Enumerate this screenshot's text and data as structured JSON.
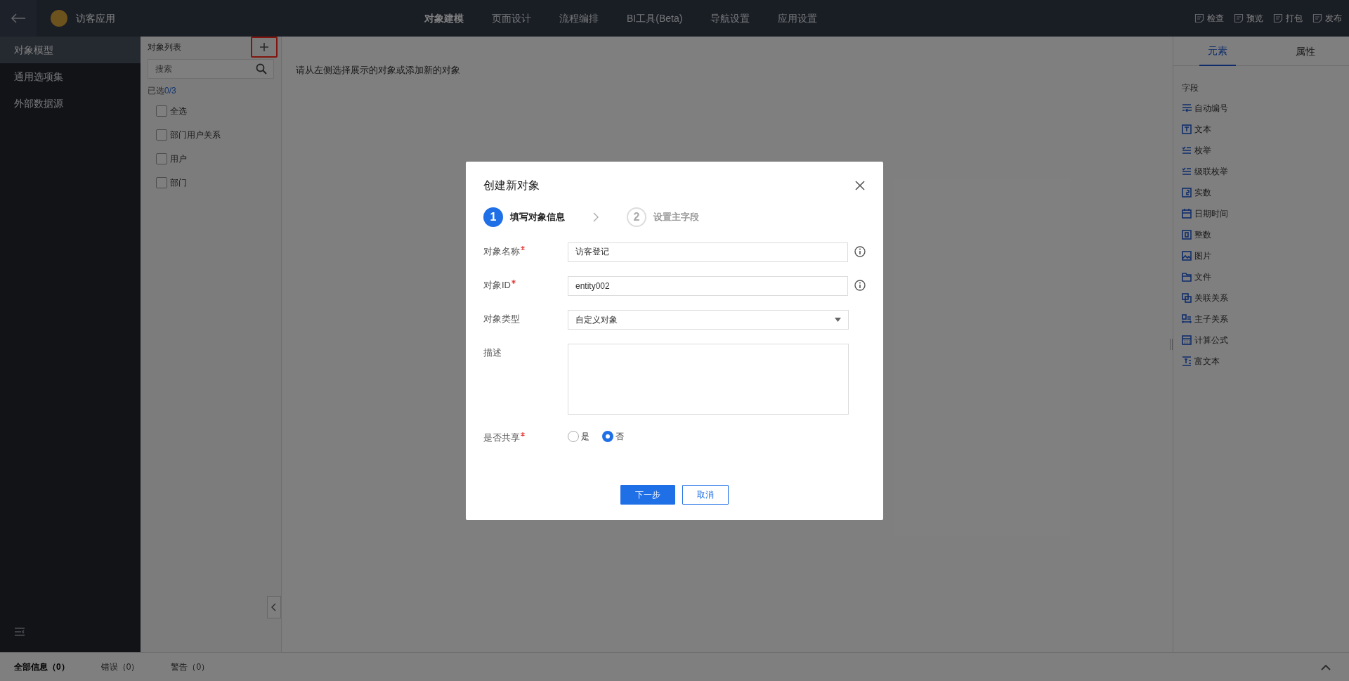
{
  "header": {
    "app_name": "访客应用",
    "nav_tabs": [
      {
        "label": "对象建模",
        "selected": true
      },
      {
        "label": "页面设计",
        "selected": false
      },
      {
        "label": "流程编排",
        "selected": false
      },
      {
        "label": "BI工具(Beta)",
        "selected": false
      },
      {
        "label": "导航设置",
        "selected": false
      },
      {
        "label": "应用设置",
        "selected": false
      }
    ],
    "actions": [
      "检查",
      "预览",
      "打包",
      "发布"
    ]
  },
  "sidebar": {
    "items": [
      {
        "label": "对象模型",
        "selected": true
      },
      {
        "label": "通用选项集",
        "selected": false
      },
      {
        "label": "外部数据源",
        "selected": false
      }
    ]
  },
  "object_list": {
    "title": "对象列表",
    "search_placeholder": "搜索",
    "selected_label": "已选",
    "selected_count": "0/3",
    "items": [
      {
        "label": "全选",
        "checked": false
      },
      {
        "label": "部门用户关系",
        "checked": false
      },
      {
        "label": "用户",
        "checked": false
      },
      {
        "label": "部门",
        "checked": false
      }
    ]
  },
  "main_hint": "请从左侧选择展示的对象或添加新的对象",
  "right_panel": {
    "tabs": [
      {
        "label": "元素",
        "selected": true
      },
      {
        "label": "属性",
        "selected": false
      }
    ],
    "section_title": "字段",
    "fields": [
      {
        "label": "自动编号",
        "kind": "autonumber"
      },
      {
        "label": "文本",
        "kind": "text"
      },
      {
        "label": "枚举",
        "kind": "enum"
      },
      {
        "label": "级联枚举",
        "kind": "enum"
      },
      {
        "label": "实数",
        "kind": "decimal"
      },
      {
        "label": "日期时间",
        "kind": "datetime"
      },
      {
        "label": "整数",
        "kind": "integer"
      },
      {
        "label": "图片",
        "kind": "image"
      },
      {
        "label": "文件",
        "kind": "file"
      },
      {
        "label": "关联关系",
        "kind": "relation"
      },
      {
        "label": "主子关系",
        "kind": "masterdetail"
      },
      {
        "label": "计算公式",
        "kind": "formula"
      },
      {
        "label": "富文本",
        "kind": "richtext"
      }
    ]
  },
  "bottom_bar": {
    "tabs": [
      {
        "label": "全部信息（0）",
        "selected": true
      },
      {
        "label": "错误（0）",
        "selected": false
      },
      {
        "label": "警告（0）",
        "selected": false
      }
    ]
  },
  "dialog": {
    "title": "创建新对象",
    "steps": [
      {
        "number": "1",
        "label": "填写对象信息",
        "active": true
      },
      {
        "number": "2",
        "label": "设置主字段",
        "active": false
      }
    ],
    "fields": [
      {
        "kind": "text",
        "label": "对象名称",
        "required": true,
        "value": "访客登记",
        "info": true
      },
      {
        "kind": "text",
        "label": "对象ID",
        "required": true,
        "value": "entity002",
        "info": true
      },
      {
        "kind": "select",
        "label": "对象类型",
        "required": false,
        "value": "自定义对象",
        "info": false
      },
      {
        "kind": "textarea",
        "label": "描述",
        "required": false,
        "info": false
      },
      {
        "kind": "radio",
        "label": "是否共享",
        "required": true,
        "info": false,
        "options": [
          {
            "label": "是",
            "selected": false
          },
          {
            "label": "否",
            "selected": true
          }
        ]
      }
    ],
    "buttons": [
      {
        "label": "下一步",
        "kind": "primary"
      },
      {
        "label": "取消",
        "kind": "secondary"
      }
    ]
  }
}
